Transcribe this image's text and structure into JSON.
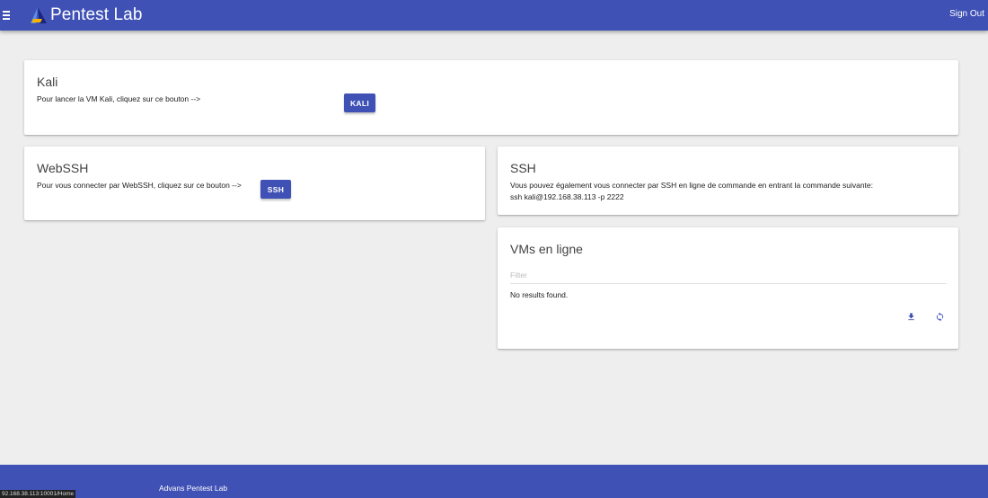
{
  "app": {
    "title": "Pentest Lab",
    "sign_out": "Sign Out"
  },
  "kali_card": {
    "title": "Kali",
    "text": "Pour lancer la VM Kali, cliquez sur ce bouton -->",
    "button": "KALI"
  },
  "webssh_card": {
    "title": "WebSSH",
    "text": "Pour vous connecter par WebSSH, cliquez sur ce bouton -->",
    "button": "SSH"
  },
  "ssh_card": {
    "title": "SSH",
    "text": "Vous pouvez également vous connecter par SSH en ligne de commande en entrant la commande suivante:",
    "command": "ssh kali@192.168.38.113 -p 2222"
  },
  "vms_card": {
    "title": "VMs en ligne",
    "filter_placeholder": "Filter",
    "filter_value": "",
    "empty_text": "No results found."
  },
  "footer": {
    "text": "Advans Pentest Lab"
  },
  "status_bar": {
    "url": "92.168.38.113:10001/Home"
  },
  "colors": {
    "primary": "#3f51b5",
    "background": "#eeeeee",
    "card": "#ffffff"
  },
  "icons": {
    "menu": "menu-icon",
    "logo": "logo-icon",
    "download": "download-icon",
    "refresh": "refresh-icon"
  }
}
